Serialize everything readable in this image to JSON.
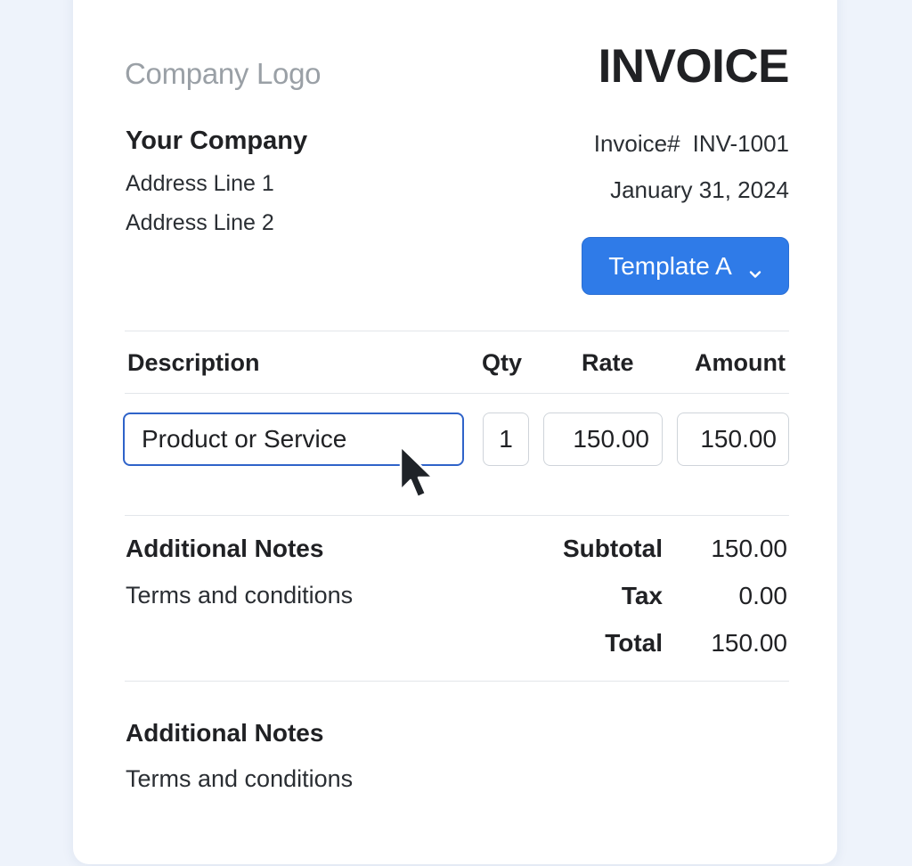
{
  "header": {
    "logo_text": "Company Logo",
    "title": "INVOICE"
  },
  "company": {
    "name": "Your Company",
    "address_line1": "Address Line 1",
    "address_line2": "Address Line 2"
  },
  "invoice": {
    "number_label": "Invoice#",
    "number": "INV-1001",
    "date": "January 31, 2024"
  },
  "template_select": {
    "selected": "Template A",
    "icon": "chevron-down-icon",
    "color": "#2f7be8"
  },
  "table": {
    "headers": {
      "description": "Description",
      "qty": "Qty",
      "rate": "Rate",
      "amount": "Amount"
    },
    "rows": [
      {
        "description": "Product or Service",
        "qty": "1",
        "rate": "150.00",
        "amount": "150.00"
      }
    ]
  },
  "notes": {
    "heading": "Additional Notes",
    "text": "Terms and conditions"
  },
  "notes_footer": {
    "heading": "Additional Notes",
    "text": "Terms and conditions"
  },
  "totals": {
    "subtotal_label": "Subtotal",
    "subtotal": "150.00",
    "tax_label": "Tax",
    "tax": "0.00",
    "total_label": "Total",
    "total": "150.00"
  },
  "cursor": {
    "icon": "mouse-pointer-icon"
  }
}
